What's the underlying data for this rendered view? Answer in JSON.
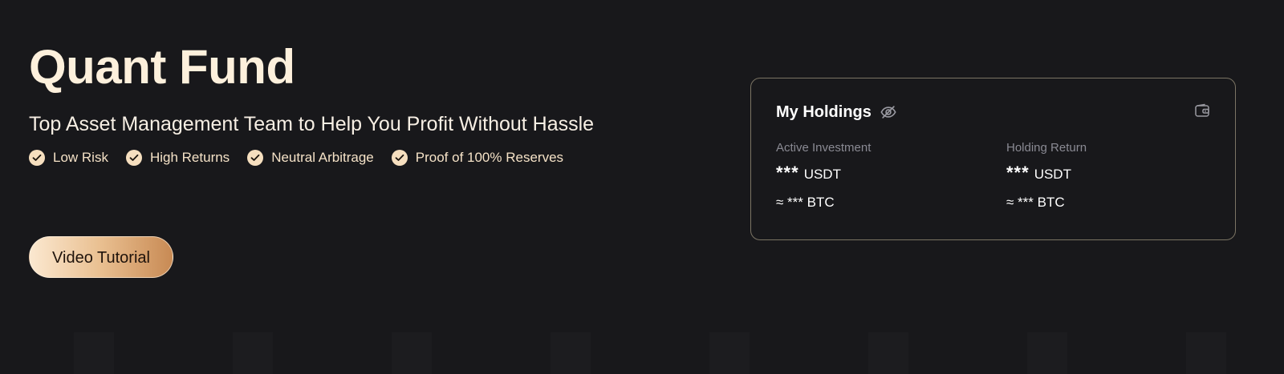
{
  "hero": {
    "title": "Quant Fund",
    "subtitle": "Top Asset Management Team to Help You Profit Without Hassle",
    "features": [
      {
        "label": "Low Risk",
        "icon": "check-circle-icon"
      },
      {
        "label": "High Returns",
        "icon": "check-circle-icon"
      },
      {
        "label": "Neutral Arbitrage",
        "icon": "check-circle-icon"
      },
      {
        "label": "Proof of 100% Reserves",
        "icon": "check-circle-icon"
      }
    ],
    "video_button_label": "Video Tutorial"
  },
  "holdings": {
    "title": "My Holdings",
    "visibility_icon": "eye-off-icon",
    "wallet_icon": "wallet-icon",
    "active_investment": {
      "label": "Active Investment",
      "amount": "***",
      "unit": "USDT",
      "approx": "≈ *** BTC"
    },
    "holding_return": {
      "label": "Holding Return",
      "amount": "***",
      "unit": "USDT",
      "approx": "≈ *** BTC"
    }
  },
  "colors": {
    "background": "#18181b",
    "title": "#fdf0dc",
    "feature_text": "#f5e2c7",
    "accent_start": "#fbe8d0",
    "accent_end": "#c88a54",
    "card_border": "#7b7464",
    "muted_label": "#8a8a93"
  }
}
